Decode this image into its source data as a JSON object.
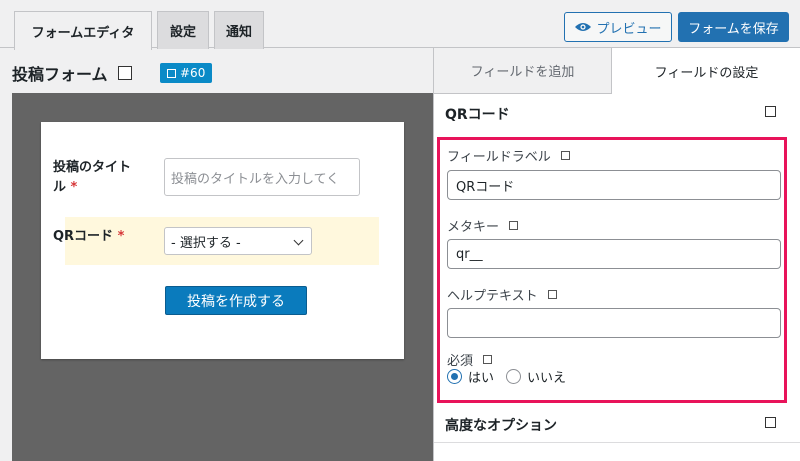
{
  "tabs": [
    {
      "label": "フォームエディタ",
      "active": true
    },
    {
      "label": "設定",
      "active": false
    },
    {
      "label": "通知",
      "active": false
    }
  ],
  "toolbar": {
    "preview_label": "プレビュー",
    "preview_icon": "eye-icon",
    "save_label": "フォームを保存"
  },
  "form": {
    "title": "投稿フォーム",
    "id_badge": "#60"
  },
  "preview": {
    "fields": [
      {
        "label": "投稿のタイトル",
        "required_mark": "*",
        "placeholder": "投稿のタイトルを入力してく"
      },
      {
        "label": "QRコード",
        "required_mark": "*",
        "selected": "- 選択する -"
      }
    ],
    "submit_label": "投稿を作成する"
  },
  "panel": {
    "tabs": [
      {
        "label": "フィールドを追加",
        "active": false
      },
      {
        "label": "フィールドの設定",
        "active": true
      }
    ],
    "section_title": "QRコード",
    "settings": {
      "field_label": {
        "label": "フィールドラベル",
        "value": "QRコード"
      },
      "meta_key": {
        "label": "メタキー",
        "value": "qr__"
      },
      "help_text": {
        "label": "ヘルプテキスト",
        "value": ""
      },
      "required": {
        "label": "必須",
        "options": [
          "はい",
          "いいえ"
        ],
        "selected": "はい"
      }
    },
    "advanced_title": "高度なオプション"
  },
  "colors": {
    "accent": "#2271b1",
    "highlight_border": "#e8135a",
    "required": "#d63638",
    "field_highlight": "#fff8dd"
  }
}
